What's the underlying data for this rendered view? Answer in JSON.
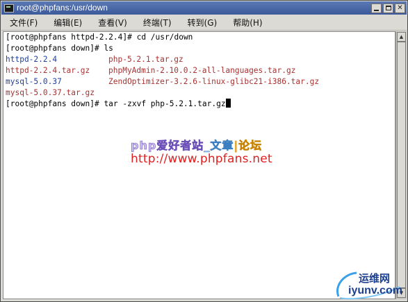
{
  "window": {
    "title": "root@phpfans:/usr/down"
  },
  "menu": [
    {
      "label": "文件(F)"
    },
    {
      "label": "编辑(E)"
    },
    {
      "label": "查看(V)"
    },
    {
      "label": "终端(T)"
    },
    {
      "label": "转到(G)"
    },
    {
      "label": "帮助(H)"
    }
  ],
  "terminal": {
    "lines": [
      {
        "col1": "[root@phpfans httpd-2.2.4]# cd /usr/down",
        "col1_class": "plain",
        "col2": "",
        "col2_class": ""
      },
      {
        "col1": "[root@phpfans down]# ls",
        "col1_class": "plain",
        "col2": "",
        "col2_class": ""
      },
      {
        "col1": "httpd-2.2.4",
        "col1_class": "dir",
        "col2": "php-5.2.1.tar.gz",
        "col2_class": "red"
      },
      {
        "col1": "httpd-2.2.4.tar.gz",
        "col1_class": "red",
        "col2": "phpMyAdmin-2.10.0.2-all-languages.tar.gz",
        "col2_class": "red"
      },
      {
        "col1": "mysql-5.0.37",
        "col1_class": "dir",
        "col2": "ZendOptimizer-3.2.6-linux-glibc21-i386.tar.gz",
        "col2_class": "red"
      },
      {
        "col1": "mysql-5.0.37.tar.gz",
        "col1_class": "red",
        "col2": "",
        "col2_class": ""
      },
      {
        "col1": "[root@phpfans down]# tar -zxvf php-5.2.1.tar.gz",
        "col1_class": "plain",
        "col2": "",
        "col2_class": "",
        "cursor": true
      }
    ]
  },
  "watermark": {
    "part1": "php爱好者站",
    "part2": "_文章",
    "part3": "|论坛",
    "url": "http://www.phpfans.net"
  },
  "corner_logo": {
    "text_cn": "运维网",
    "text_en": "iyunv.com"
  },
  "colors": {
    "titlebar": "#3c5a9a",
    "terminal_bg": "#ffffff",
    "dir_text": "#1f3fa0",
    "archive_text": "#a83232",
    "watermark_url": "#e02020"
  }
}
